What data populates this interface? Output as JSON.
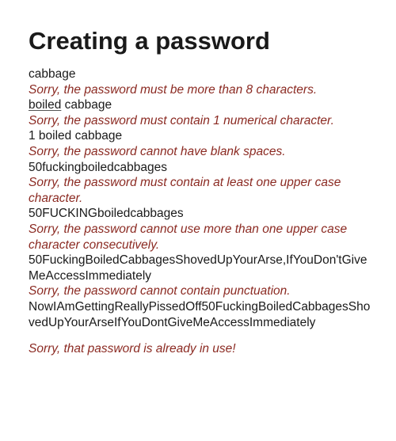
{
  "title": "Creating a password",
  "lines": [
    {
      "type": "pw",
      "text": "cabbage"
    },
    {
      "type": "err",
      "text": "Sorry, the password must be more than 8 characters."
    },
    {
      "type": "pw",
      "text_underlined": "boiled",
      "text_rest": " cabbage"
    },
    {
      "type": "err",
      "text": "Sorry, the password must contain 1 numerical character."
    },
    {
      "type": "pw",
      "text": "1 boiled cabbage"
    },
    {
      "type": "err",
      "text": "Sorry, the password cannot have blank spaces."
    },
    {
      "type": "pw",
      "text": "50fuckingboiledcabbages"
    },
    {
      "type": "err",
      "text": "Sorry, the password must contain at least one upper case character."
    },
    {
      "type": "pw",
      "text": "50FUCKINGboiledcabbages"
    },
    {
      "type": "err",
      "text": "Sorry, the password cannot use more than one upper case character consecutively."
    },
    {
      "type": "pw",
      "text": "50FuckingBoiledCabbagesShovedUpYourArse,IfYouDon'tGiveMeAccessImmediately"
    },
    {
      "type": "err",
      "text": "Sorry, the password cannot contain punctuation."
    },
    {
      "type": "pw",
      "text": "NowIAmGettingReallyPissedOff50FuckingBoiledCabbagesShovedUpYourArseIfYouDontGiveMeAccessImmediately"
    },
    {
      "type": "err",
      "text": "Sorry, that password is already in use!"
    }
  ]
}
